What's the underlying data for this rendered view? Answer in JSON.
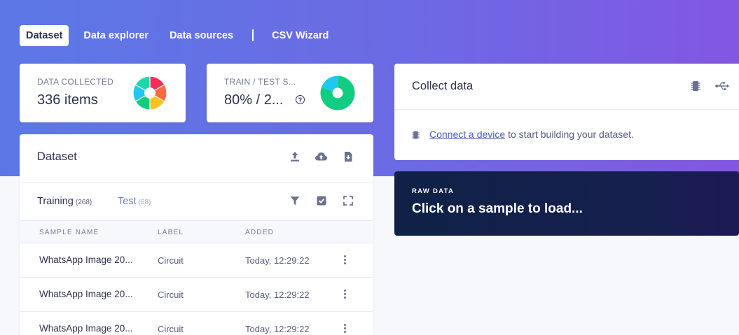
{
  "nav": {
    "tabs": [
      {
        "label": "Dataset",
        "active": true
      },
      {
        "label": "Data explorer",
        "active": false
      },
      {
        "label": "Data sources",
        "active": false
      },
      {
        "label": "CSV Wizard",
        "active": false
      }
    ]
  },
  "stats": {
    "collected_label": "DATA COLLECTED",
    "collected_value": "336 items",
    "split_label": "TRAIN / TEST S...",
    "split_value": "80% / 2...",
    "help_glyph": "?",
    "split_train_fraction": 0.8
  },
  "dataset": {
    "title": "Dataset",
    "icons": [
      "upload-icon",
      "cloud-upload-icon",
      "export-icon"
    ],
    "tabs": [
      {
        "label": "Training",
        "count": "(268)",
        "active": true
      },
      {
        "label": "Test",
        "count": "(68)",
        "active": false
      }
    ],
    "tool_icons": [
      "filter-icon",
      "select-checkbox-icon",
      "expand-icon"
    ],
    "columns": [
      "SAMPLE NAME",
      "LABEL",
      "ADDED"
    ],
    "rows": [
      {
        "name": "WhatsApp Image 20...",
        "label": "Circuit",
        "added": "Today, 12:29:22"
      },
      {
        "name": "WhatsApp Image 20...",
        "label": "Circuit",
        "added": "Today, 12:29:22"
      },
      {
        "name": "WhatsApp Image 20...",
        "label": "Circuit",
        "added": "Today, 12:29:22"
      }
    ]
  },
  "collect": {
    "title": "Collect data",
    "icons": [
      "device-chip-icon",
      "usb-icon"
    ],
    "link_text": "Connect a device",
    "body_text": " to start building your dataset."
  },
  "raw": {
    "label": "RAW DATA",
    "title": "Click on a sample to load..."
  },
  "colors": {
    "primary": "#5b78e6",
    "accent": "#8257e2",
    "split_train": "#12cc82",
    "split_test": "#1ec8ee",
    "pie_slices": [
      "#ff2a55",
      "#ff6b3d",
      "#ffc21e",
      "#12cc82",
      "#1ec8ee",
      "#18d9a8"
    ]
  }
}
